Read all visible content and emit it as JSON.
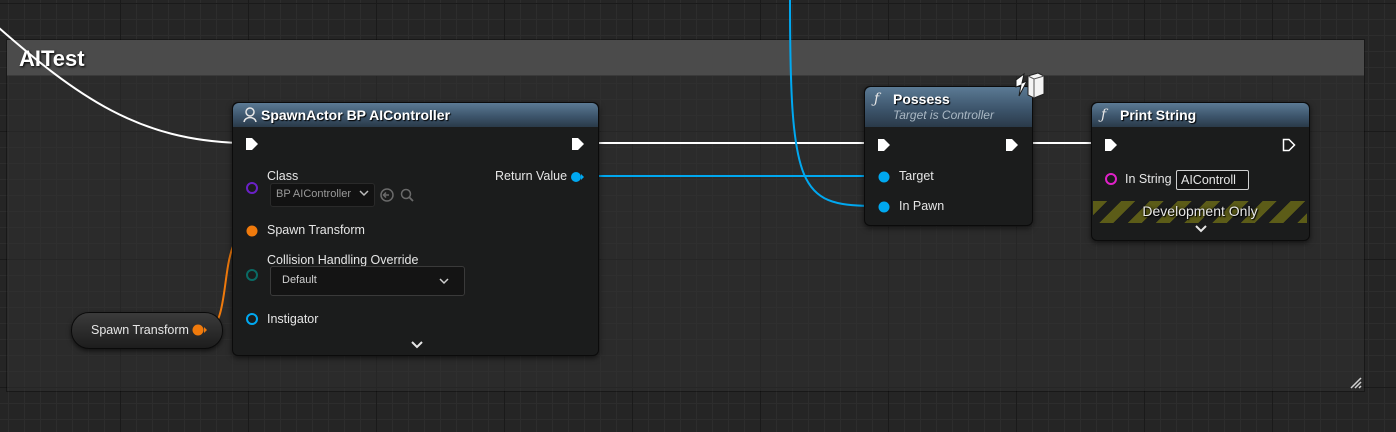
{
  "comment": {
    "title": "AITest"
  },
  "nodes": {
    "spawn_actor": {
      "title": "SpawnActor BP AIController",
      "class_label": "Class",
      "class_value": "BP AIController",
      "return_value_label": "Return Value",
      "spawn_transform_label": "Spawn Transform",
      "collision_label": "Collision Handling Override",
      "collision_value": "Default",
      "instigator_label": "Instigator"
    },
    "possess": {
      "title": "Possess",
      "subtitle": "Target is Controller",
      "target_label": "Target",
      "in_pawn_label": "In Pawn"
    },
    "print_string": {
      "title": "Print String",
      "in_string_label": "In String",
      "in_string_value": "AIControll",
      "development_only_label": "Development Only"
    },
    "spawn_transform_var": {
      "label": "Spawn Transform"
    }
  },
  "icons": {
    "function": "function-icon",
    "spawn": "spawn-actor-icon",
    "network": "server-icon"
  },
  "colors": {
    "exec": "#ffffff",
    "object_pin": "#00a8f0",
    "struct_pin": "#f07a0c",
    "class_pin": "#6a21c6",
    "string_pin": "#e021c8",
    "enum_pin": "#0a6a64"
  }
}
